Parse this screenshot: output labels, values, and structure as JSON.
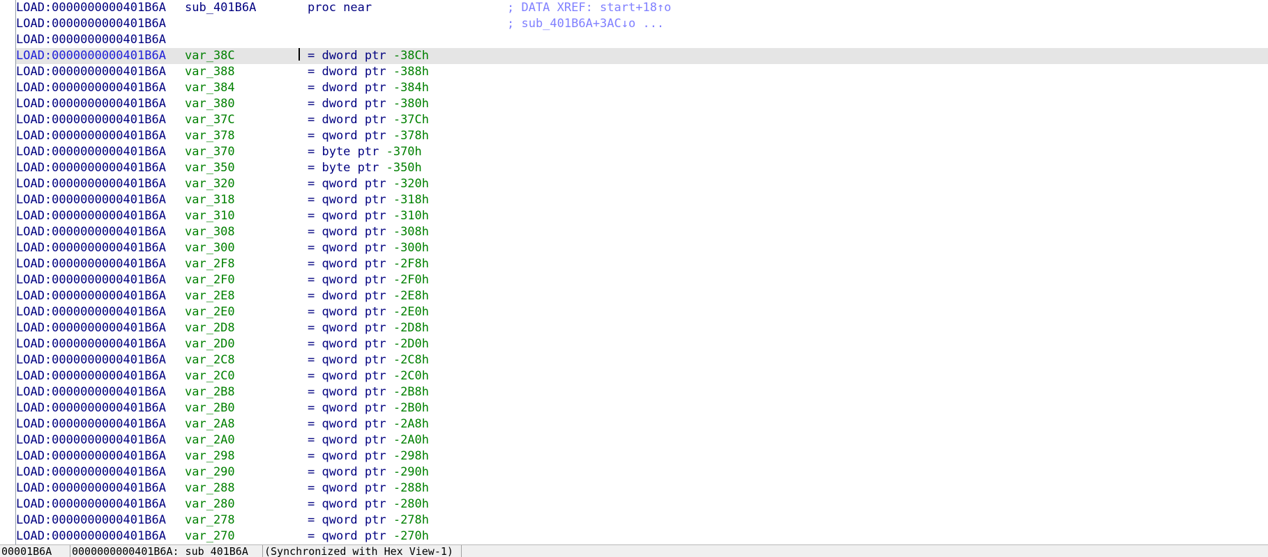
{
  "listing": {
    "header_rows": [
      {
        "addr": "LOAD:0000000000401B6A",
        "label": "sub_401B6A",
        "op": "proc near",
        "comment": "; DATA XREF: start+18↑o"
      },
      {
        "addr": "LOAD:0000000000401B6A",
        "label": "",
        "op": "",
        "comment": "; sub_401B6A+3AC↓o ..."
      },
      {
        "addr": "LOAD:0000000000401B6A",
        "label": "",
        "op": "",
        "comment": ""
      }
    ],
    "var_rows": [
      {
        "addr": "LOAD:0000000000401B6A",
        "label": "var_38C",
        "type": "= dword ptr ",
        "offset": "-38Ch"
      },
      {
        "addr": "LOAD:0000000000401B6A",
        "label": "var_388",
        "type": "= dword ptr ",
        "offset": "-388h"
      },
      {
        "addr": "LOAD:0000000000401B6A",
        "label": "var_384",
        "type": "= dword ptr ",
        "offset": "-384h"
      },
      {
        "addr": "LOAD:0000000000401B6A",
        "label": "var_380",
        "type": "= dword ptr ",
        "offset": "-380h"
      },
      {
        "addr": "LOAD:0000000000401B6A",
        "label": "var_37C",
        "type": "= dword ptr ",
        "offset": "-37Ch"
      },
      {
        "addr": "LOAD:0000000000401B6A",
        "label": "var_378",
        "type": "= qword ptr ",
        "offset": "-378h"
      },
      {
        "addr": "LOAD:0000000000401B6A",
        "label": "var_370",
        "type": "= byte ptr ",
        "offset": "-370h"
      },
      {
        "addr": "LOAD:0000000000401B6A",
        "label": "var_350",
        "type": "= byte ptr ",
        "offset": "-350h"
      },
      {
        "addr": "LOAD:0000000000401B6A",
        "label": "var_320",
        "type": "= qword ptr ",
        "offset": "-320h"
      },
      {
        "addr": "LOAD:0000000000401B6A",
        "label": "var_318",
        "type": "= qword ptr ",
        "offset": "-318h"
      },
      {
        "addr": "LOAD:0000000000401B6A",
        "label": "var_310",
        "type": "= qword ptr ",
        "offset": "-310h"
      },
      {
        "addr": "LOAD:0000000000401B6A",
        "label": "var_308",
        "type": "= qword ptr ",
        "offset": "-308h"
      },
      {
        "addr": "LOAD:0000000000401B6A",
        "label": "var_300",
        "type": "= qword ptr ",
        "offset": "-300h"
      },
      {
        "addr": "LOAD:0000000000401B6A",
        "label": "var_2F8",
        "type": "= qword ptr ",
        "offset": "-2F8h"
      },
      {
        "addr": "LOAD:0000000000401B6A",
        "label": "var_2F0",
        "type": "= qword ptr ",
        "offset": "-2F0h"
      },
      {
        "addr": "LOAD:0000000000401B6A",
        "label": "var_2E8",
        "type": "= dword ptr ",
        "offset": "-2E8h"
      },
      {
        "addr": "LOAD:0000000000401B6A",
        "label": "var_2E0",
        "type": "= qword ptr ",
        "offset": "-2E0h"
      },
      {
        "addr": "LOAD:0000000000401B6A",
        "label": "var_2D8",
        "type": "= qword ptr ",
        "offset": "-2D8h"
      },
      {
        "addr": "LOAD:0000000000401B6A",
        "label": "var_2D0",
        "type": "= qword ptr ",
        "offset": "-2D0h"
      },
      {
        "addr": "LOAD:0000000000401B6A",
        "label": "var_2C8",
        "type": "= qword ptr ",
        "offset": "-2C8h"
      },
      {
        "addr": "LOAD:0000000000401B6A",
        "label": "var_2C0",
        "type": "= qword ptr ",
        "offset": "-2C0h"
      },
      {
        "addr": "LOAD:0000000000401B6A",
        "label": "var_2B8",
        "type": "= qword ptr ",
        "offset": "-2B8h"
      },
      {
        "addr": "LOAD:0000000000401B6A",
        "label": "var_2B0",
        "type": "= qword ptr ",
        "offset": "-2B0h"
      },
      {
        "addr": "LOAD:0000000000401B6A",
        "label": "var_2A8",
        "type": "= qword ptr ",
        "offset": "-2A8h"
      },
      {
        "addr": "LOAD:0000000000401B6A",
        "label": "var_2A0",
        "type": "= qword ptr ",
        "offset": "-2A0h"
      },
      {
        "addr": "LOAD:0000000000401B6A",
        "label": "var_298",
        "type": "= qword ptr ",
        "offset": "-298h"
      },
      {
        "addr": "LOAD:0000000000401B6A",
        "label": "var_290",
        "type": "= qword ptr ",
        "offset": "-290h"
      },
      {
        "addr": "LOAD:0000000000401B6A",
        "label": "var_288",
        "type": "= qword ptr ",
        "offset": "-288h"
      },
      {
        "addr": "LOAD:0000000000401B6A",
        "label": "var_280",
        "type": "= qword ptr ",
        "offset": "-280h"
      },
      {
        "addr": "LOAD:0000000000401B6A",
        "label": "var_278",
        "type": "= qword ptr ",
        "offset": "-278h"
      },
      {
        "addr": "LOAD:0000000000401B6A",
        "label": "var_270",
        "type": "= qword ptr ",
        "offset": "-270h"
      }
    ],
    "highlighted_var_index": 0
  },
  "status_bar": {
    "file_offset": "00001B6A",
    "location": "0000000000401B6A: sub_401B6A",
    "sync": "(Synchronized with Hex View-1)"
  },
  "colors": {
    "address": "#000080",
    "address_highlight": "#2020d8",
    "variable": "#008000",
    "keyword": "#000080",
    "number": "#008000",
    "comment": "#8080ff",
    "highlight_row": "#e5e5e5"
  }
}
